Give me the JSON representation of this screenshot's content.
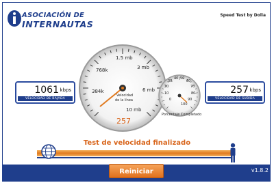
{
  "header": {
    "logo_line1": "ASOCIACIÓN DE",
    "logo_line2": "INTERNAUTAS",
    "right_text": "Speed Test by Dolia"
  },
  "download": {
    "value": "1061",
    "unit": "kbps",
    "caption": "VELOCIDAD DE BAJADA"
  },
  "upload": {
    "value": "257",
    "unit": "kbps",
    "caption": "VELOCIDAD DE SUBIDA"
  },
  "speed_gauge": {
    "ticks": [
      "384k",
      "768k",
      "1.5 mb",
      "3 mb",
      "6 mb",
      "10 mb"
    ],
    "center_label_1": "Velocidad",
    "center_label_2": "de la línea",
    "readout": "257",
    "needle_value": "257k"
  },
  "percent_gauge": {
    "ticks": [
      "0",
      "10",
      "20",
      "30",
      "40",
      "50",
      "60",
      "70",
      "80",
      "90",
      "100"
    ],
    "label": "Porcentaje Completado",
    "needle_value_percent": 100
  },
  "status_text": "Test de velocidad finalizado",
  "restart_label": "Reiniciar",
  "version": "v1.8.2",
  "colors": {
    "brand_blue": "#1f3e8c",
    "accent_orange": "#e0701c",
    "status_orange": "#d8641a"
  }
}
